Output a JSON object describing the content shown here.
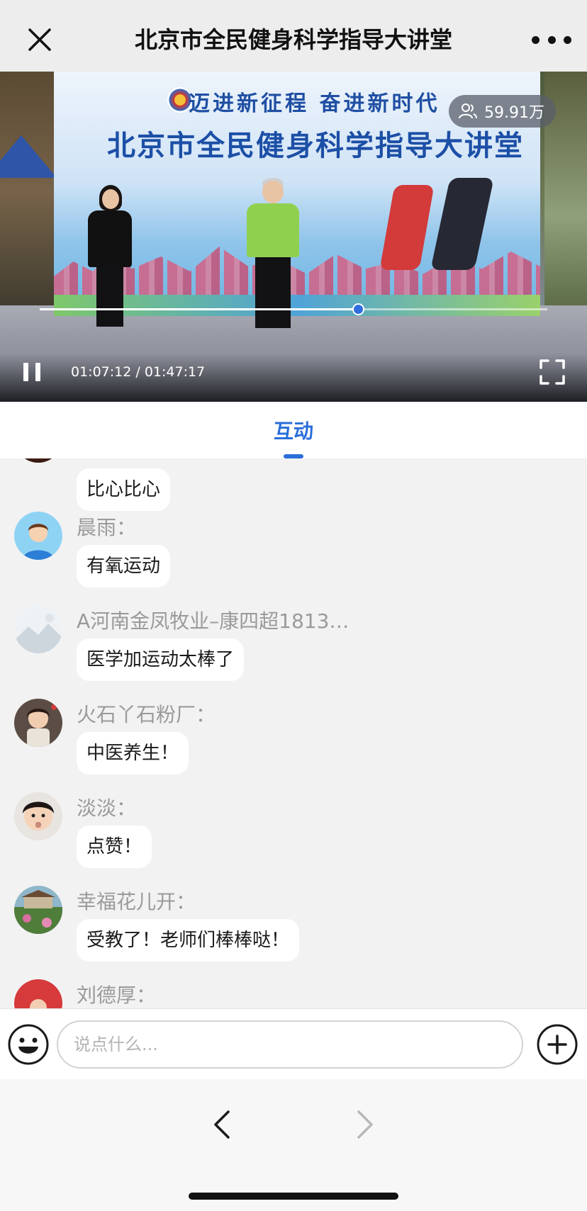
{
  "header": {
    "title": "北京市全民健身科学指导大讲堂"
  },
  "video": {
    "viewers": "59.91万",
    "backdrop_slogan": "迈进新征程  奋进新时代",
    "backdrop_title": "北京市全民健身科学指导大讲堂",
    "progress": 0.627,
    "time": "01:07:12 / 01:47:17",
    "state": "playing"
  },
  "tabs": [
    {
      "label": "互动",
      "active": true
    }
  ],
  "chat": {
    "messages": [
      {
        "user": "",
        "text": "比心比心",
        "avatar": "dark-avatar-icon"
      },
      {
        "user": "晨雨：",
        "text": "有氧运动",
        "avatar": "user-avatar-icon"
      },
      {
        "user": "A河南金凤牧业–康四超1813…",
        "text": "医学加运动太棒了",
        "avatar": "landscape-avatar-icon"
      },
      {
        "user": "火石丫石粉厂：",
        "text": "中医养生！",
        "avatar": "child-photo-avatar"
      },
      {
        "user": "淡淡：",
        "text": "点赞！",
        "avatar": "child-photo-avatar"
      },
      {
        "user": "幸福花儿开：",
        "text": "受教了！老师们棒棒哒！",
        "avatar": "garden-photo-avatar"
      },
      {
        "user": "刘德厚：",
        "text": "",
        "avatar": "red-photo-avatar"
      }
    ]
  },
  "input": {
    "placeholder": "说点什么..."
  },
  "colors": {
    "accent": "#2a6ed9",
    "progress_knob": "#2f6ee0"
  }
}
